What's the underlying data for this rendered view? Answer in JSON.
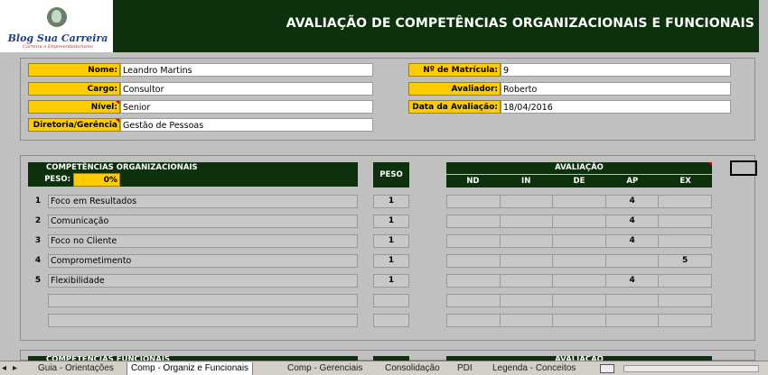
{
  "header": {
    "logo_line1": "Blog Sua Carreira",
    "logo_line2": "Carreira e Empreendedorismo",
    "title": "AVALIAÇÃO DE COMPETÊNCIAS ORGANIZACIONAIS E FUNCIONAIS"
  },
  "info": {
    "nome_label": "Nome:",
    "nome_value": "Leandro Martins",
    "cargo_label": "Cargo:",
    "cargo_value": "Consultor",
    "nivel_label": "Nível:",
    "nivel_value": "Senior",
    "diretoria_label": "Diretoria/Gerência",
    "diretoria_value": "Gestão de Pessoas",
    "matricula_label": "Nº de Matrícula:",
    "matricula_value": "9",
    "avaliador_label": "Avaliador:",
    "avaliador_value": "Roberto",
    "data_label": "Data da Avaliação:",
    "data_value": "18/04/2016"
  },
  "org": {
    "section_title": "COMPETÊNCIAS ORGANIZACIONAIS",
    "peso_label": "PESO:",
    "peso_value": "0%",
    "peso_col": "PESO",
    "avaliacao_title": "AVALIAÇÃO",
    "columns": [
      "ND",
      "IN",
      "DE",
      "AP",
      "EX"
    ],
    "rows": [
      {
        "n": "1",
        "name": "Foco em Resultados",
        "peso": "1",
        "scores": [
          "",
          "",
          "",
          "4",
          ""
        ]
      },
      {
        "n": "2",
        "name": "Comunicação",
        "peso": "1",
        "scores": [
          "",
          "",
          "",
          "4",
          ""
        ]
      },
      {
        "n": "3",
        "name": "Foco no Cliente",
        "peso": "1",
        "scores": [
          "",
          "",
          "",
          "4",
          ""
        ]
      },
      {
        "n": "4",
        "name": "Comprometimento",
        "peso": "1",
        "scores": [
          "",
          "",
          "",
          "",
          "5"
        ]
      },
      {
        "n": "5",
        "name": "Flexibilidade",
        "peso": "1",
        "scores": [
          "",
          "",
          "",
          "4",
          ""
        ]
      },
      {
        "n": "",
        "name": "",
        "peso": "",
        "scores": [
          "",
          "",
          "",
          "",
          ""
        ]
      },
      {
        "n": "",
        "name": "",
        "peso": "",
        "scores": [
          "",
          "",
          "",
          "",
          ""
        ]
      }
    ]
  },
  "func": {
    "section_title": "COMPETÊNCIAS FUNCIONAIS",
    "avaliacao_title": "AVALIAÇÃO"
  },
  "sheet_tabs": [
    "Guia - Orientações",
    "Comp - Organiz e Funcionais",
    "Comp - Gerenciais",
    "Consolidação",
    "PDI",
    "Legenda - Conceitos"
  ],
  "active_tab": 1
}
